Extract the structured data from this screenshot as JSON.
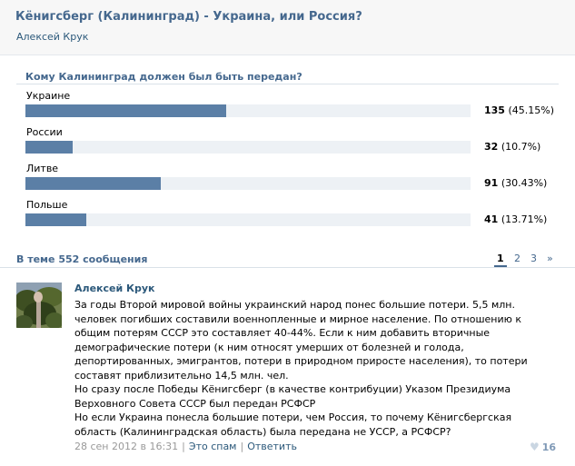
{
  "topic": {
    "title": "Кёнигсберг (Калининград) - Украина, или Россия?",
    "author": "Алексей Крук"
  },
  "poll": {
    "question": "Кому Калининград должен был быть передан?",
    "options": [
      {
        "label": "Украине",
        "count": "135",
        "percent": "(45.15%)",
        "share": 0.4515
      },
      {
        "label": "России",
        "count": "32",
        "percent": "(10.7%)",
        "share": 0.107
      },
      {
        "label": "Литве",
        "count": "91",
        "percent": "(30.43%)",
        "share": 0.3043
      },
      {
        "label": "Польше",
        "count": "41",
        "percent": "(13.71%)",
        "share": 0.1371
      }
    ]
  },
  "discussion": {
    "summary": "В теме 552 сообщения",
    "pages": [
      "1",
      "2",
      "3",
      "»"
    ],
    "active_page": "1"
  },
  "post": {
    "author": "Алексей Крук",
    "paragraphs": [
      "За годы Второй мировой войны украинский народ понес большие потери. 5,5 млн. человек погибших составили военнопленные и мирное население. По отношению к общим потерям СССР это составляет 40-44%. Если к ним добавить вторичные демографические потери (к ним относят умерших от болезней и голода, депортированных, эмигрантов, потери в природном приросте населения), то потери составят приблизительно 14,5 млн. чел.",
      "Но сразу после Победы Кёнигсберг (в качестве контрибуции) Указом Президиума Верховного Совета СССР был передан РСФСР",
      "Но если Украина понесла большие потери, чем Россия, то почему Кёнигсбергская область (Калининградская область) была передана не УССР, а РСФСР?"
    ],
    "date": "28 сен 2012 в 16:31",
    "spam_link": "Это спам",
    "reply_link": "Ответить",
    "likes": "16",
    "like_icon": "heart-icon"
  },
  "colors": {
    "link": "#45688e",
    "bar": "#5b7fa6",
    "track": "#edf1f5"
  }
}
